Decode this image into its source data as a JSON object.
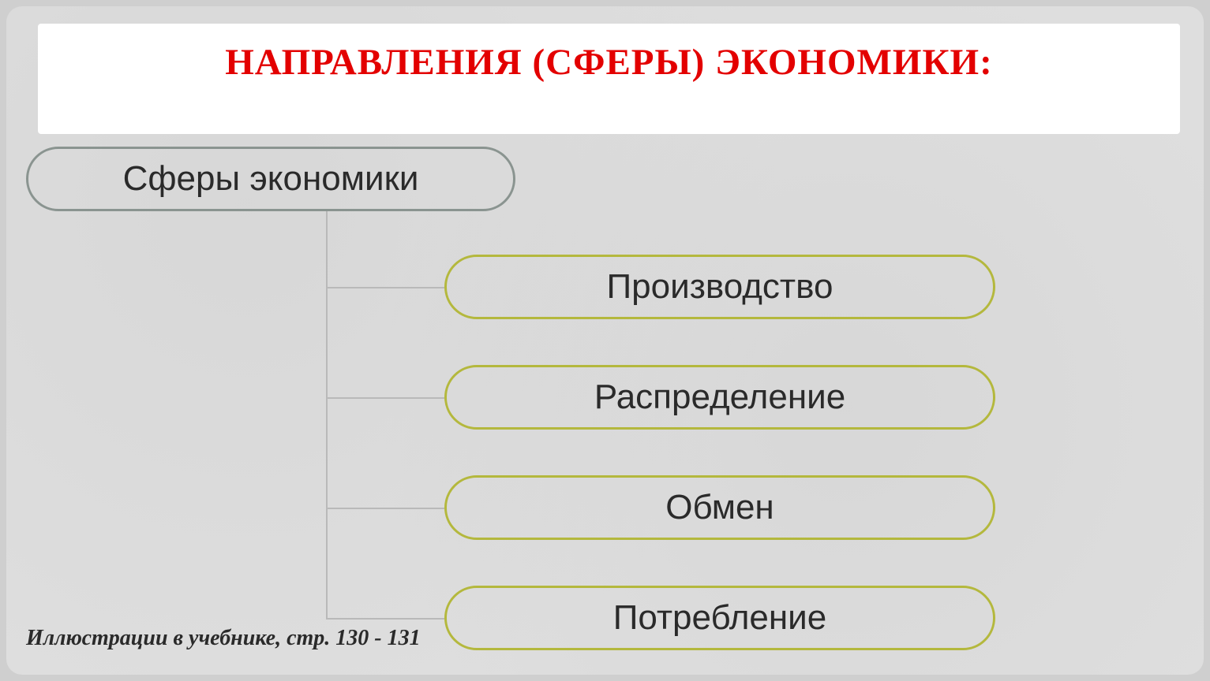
{
  "title": "НАПРАВЛЕНИЯ (СФЕРЫ) ЭКОНОМИКИ:",
  "diagram": {
    "root": "Сферы экономики",
    "children": [
      "Производство",
      "Распределение",
      "Обмен",
      "Потребление"
    ]
  },
  "footnote": "Иллюстрации в учебнике, стр. 130 - 131",
  "colors": {
    "title": "#e30000",
    "root_border": "#8a9490",
    "child_border": "#b4b83d",
    "connector": "#b9b9b9"
  }
}
